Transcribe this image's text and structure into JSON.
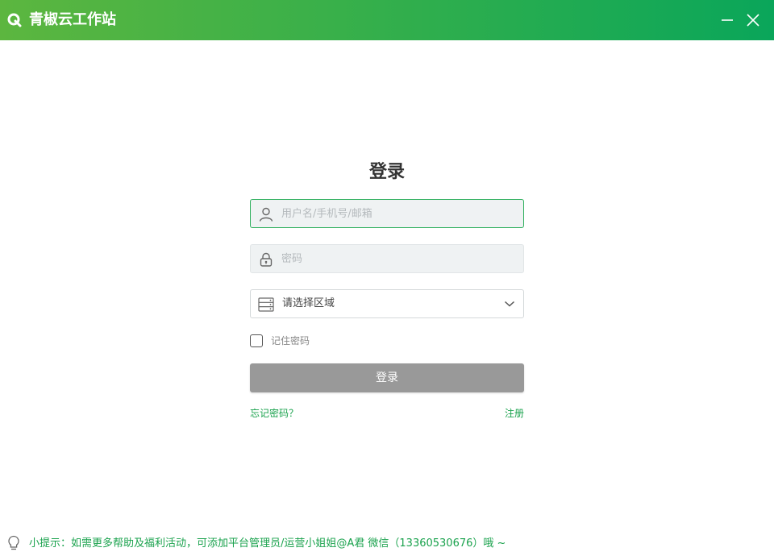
{
  "window": {
    "title": "青椒云工作站",
    "logo_icon": "app-logo-icon",
    "minimize_icon": "minimize-icon",
    "close_icon": "close-icon",
    "brand_color": "#2fae4d"
  },
  "login": {
    "heading": "登录",
    "username": {
      "placeholder": "用户名/手机号/邮箱",
      "value": "",
      "icon": "user-icon"
    },
    "password": {
      "placeholder": "密码",
      "value": "",
      "icon": "lock-icon"
    },
    "region": {
      "selected": "请选择区域",
      "icon": "server-icon",
      "dropdown_icon": "chevron-down-icon"
    },
    "remember_label": "记住密码",
    "remember_checked": false,
    "submit_label": "登录",
    "forgot_label": "忘记密码？",
    "register_label": "注册"
  },
  "footer": {
    "tip_text": "小提示：如需更多帮助及福利活动，可添加平台管理员/运营小姐姐@A君 微信（13360530676）哦 ~",
    "tip_icon": "lightbulb-icon"
  },
  "colors": {
    "accent": "#1aa24d",
    "button_disabled": "#999999"
  }
}
